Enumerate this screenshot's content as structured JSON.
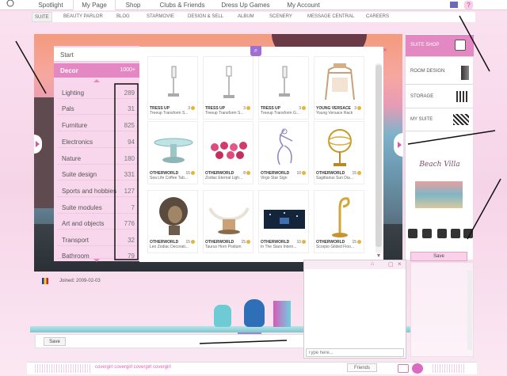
{
  "topnav": {
    "items": [
      {
        "label": "Spotlight"
      },
      {
        "label": "My Page",
        "active": true
      },
      {
        "label": "Shop"
      },
      {
        "label": "Clubs & Friends"
      },
      {
        "label": "Dress Up Games"
      },
      {
        "label": "My Account"
      }
    ]
  },
  "subnav": {
    "items": [
      {
        "label": "SUITE",
        "active": true
      },
      {
        "label": "BEAUTY PARLOR"
      },
      {
        "label": "BLOG"
      },
      {
        "label": "STARMOVIE"
      },
      {
        "label": "DESIGN & SELL"
      },
      {
        "label": "ALBUM"
      },
      {
        "label": "SCENERY"
      },
      {
        "label": "MESSAGE CENTRAL"
      },
      {
        "label": "CAREERS"
      }
    ]
  },
  "categories": {
    "start_label": "Start",
    "current": {
      "label": "Decor",
      "count": "1000+"
    },
    "items": [
      {
        "label": "Lighting",
        "count": "289"
      },
      {
        "label": "Pals",
        "count": "31"
      },
      {
        "label": "Furniture",
        "count": "825"
      },
      {
        "label": "Electronics",
        "count": "94"
      },
      {
        "label": "Nature",
        "count": "180"
      },
      {
        "label": "Suite design",
        "count": "331"
      },
      {
        "label": "Sports and hobbies",
        "count": "127"
      },
      {
        "label": "Suite modules",
        "count": "7"
      },
      {
        "label": "Art and objects",
        "count": "776"
      },
      {
        "label": "Transport",
        "count": "32"
      },
      {
        "label": "Bathroom",
        "count": "79"
      }
    ]
  },
  "items": [
    {
      "brand": "TRESS UP",
      "name": "Treeup Transform S...",
      "price": "3"
    },
    {
      "brand": "TRESS UP",
      "name": "Treeup Transform S...",
      "price": "3"
    },
    {
      "brand": "TRESS UP",
      "name": "Treeup Transform G...",
      "price": "3"
    },
    {
      "brand": "YOUNG VERSACE",
      "name": "Young Versace Rack",
      "price": "3"
    },
    {
      "brand": "OTHERWORLD",
      "name": "Sea Life Coffee Tab...",
      "price": "15"
    },
    {
      "brand": "OTHERWORLD",
      "name": "Zodiac Eternal Ligh...",
      "price": "8"
    },
    {
      "brand": "OTHERWORLD",
      "name": "Virgo Star Sign",
      "price": "10"
    },
    {
      "brand": "OTHERWORLD",
      "name": "Sagittarius Sun Dia...",
      "price": "15"
    },
    {
      "brand": "OTHERWORLD",
      "name": "Leo Zodiac Decorati...",
      "price": "15"
    },
    {
      "brand": "OTHERWORLD",
      "name": "Taurus Horn Podium",
      "price": "15"
    },
    {
      "brand": "OTHERWORLD",
      "name": "In The Stars Intern...",
      "price": "10"
    },
    {
      "brand": "OTHERWORLD",
      "name": "Scorpio Gilded Floo...",
      "price": "15"
    }
  ],
  "right_menu": {
    "items": [
      {
        "label": "SUITE SHOP",
        "active": true
      },
      {
        "label": "ROOM DESIGN"
      },
      {
        "label": "STORAGE"
      },
      {
        "label": "MY SUITE"
      }
    ],
    "save_label": "Save"
  },
  "profile": {
    "joined": "Joined: 2009-02-03",
    "save_label": "Save"
  },
  "chat": {
    "placeholder": "Type here..."
  },
  "bottom": {
    "text": "covergirl covergirl covergirl covergirl",
    "friends_label": "Friends"
  },
  "colors": {
    "accent": "#e488c4",
    "panel": "#f8d7ec",
    "annotation": "#111111"
  }
}
